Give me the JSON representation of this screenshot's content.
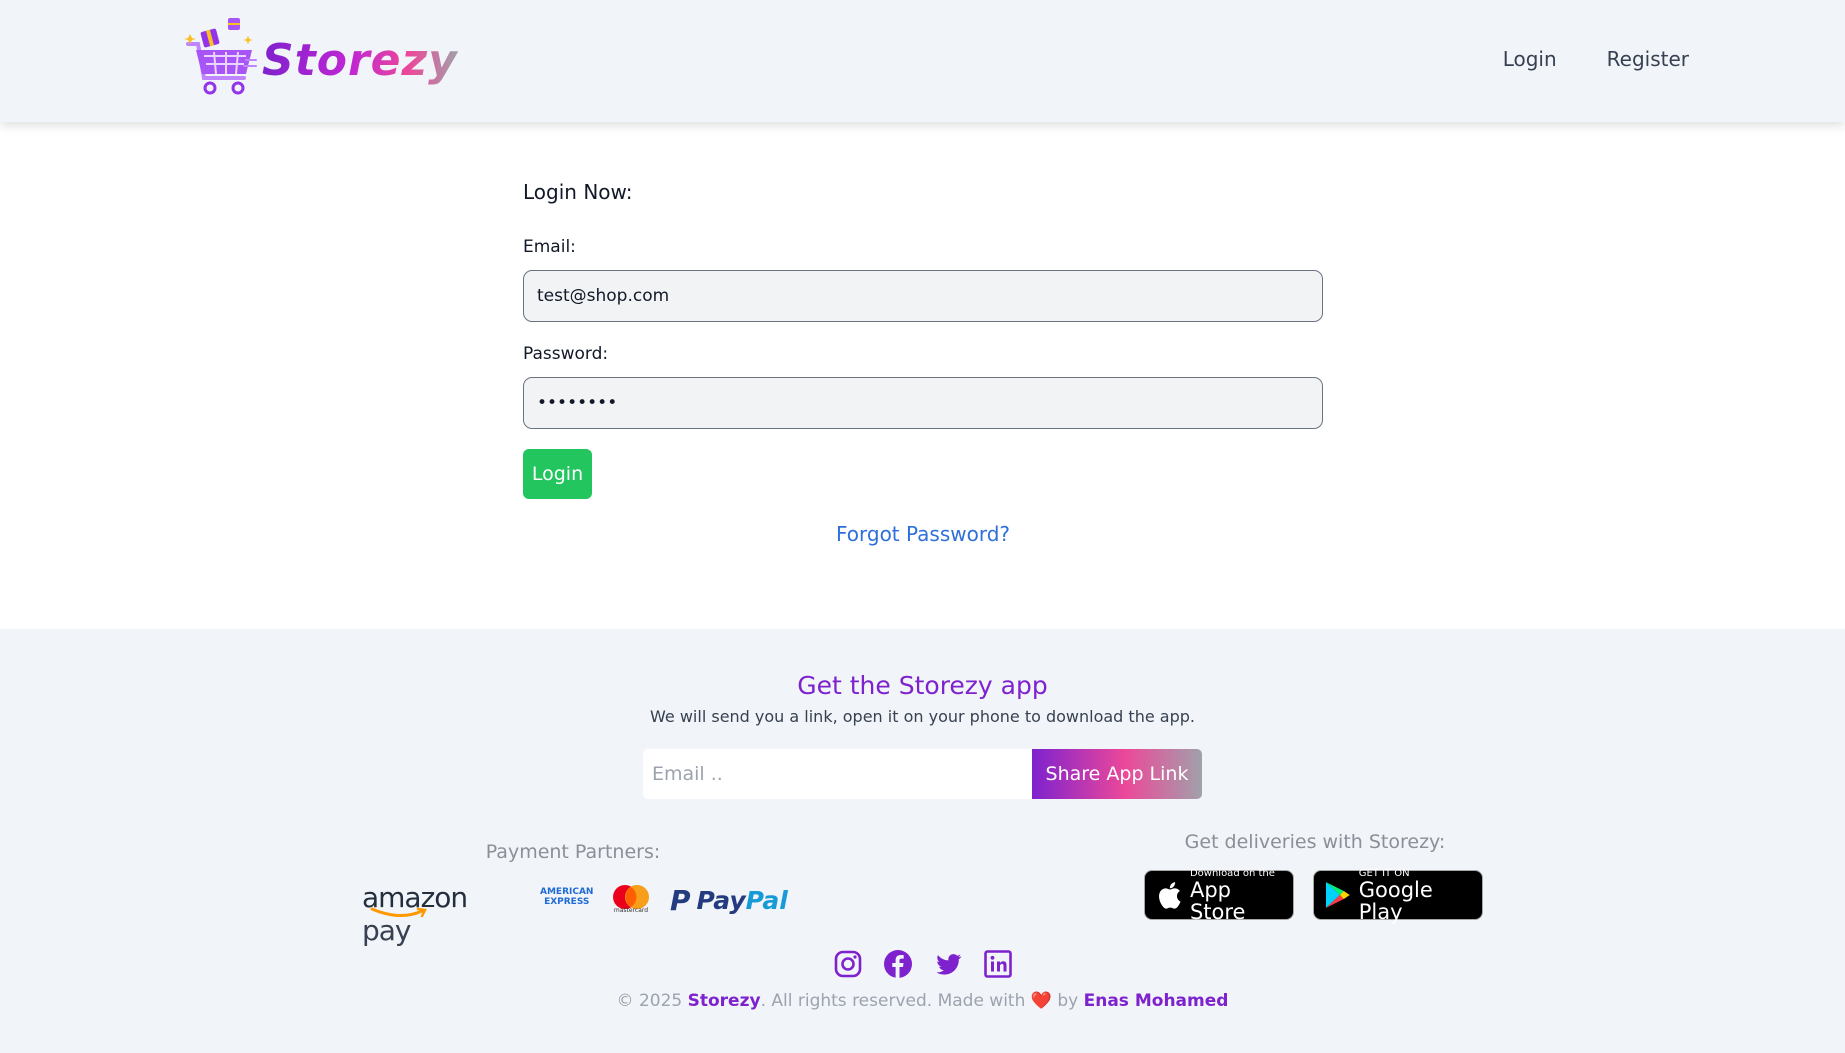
{
  "header": {
    "brand": "Storezy",
    "nav": {
      "login": "Login",
      "register": "Register"
    }
  },
  "login_form": {
    "title": "Login Now:",
    "email_label": "Email:",
    "email_value": "test@shop.com",
    "password_label": "Password:",
    "password_value": "••••••••",
    "submit_label": "Login",
    "forgot_link": "Forgot Password?"
  },
  "footer": {
    "app_title": "Get the Storezy app",
    "app_subtitle": "We will send you a link, open it on your phone to download the app.",
    "share_placeholder": "Email ..",
    "share_button": "Share App Link",
    "payment_label": "Payment Partners:",
    "delivery_label": "Get deliveries with Storezy:",
    "payment_partners": {
      "amazon": "amazon",
      "amazon_pay": "pay",
      "amex_line1": "AMERICAN",
      "amex_line2": "EXPRESS",
      "mastercard": "mastercard",
      "paypal_pay": "Pay",
      "paypal_pal": "Pal"
    },
    "app_store": {
      "small": "Download on the",
      "big": "App Store"
    },
    "google_play": {
      "small": "GET IT ON",
      "big": "Google Play"
    },
    "social_icons": [
      "instagram-icon",
      "facebook-icon",
      "twitter-icon",
      "linkedin-icon"
    ],
    "copyright": {
      "prefix": "© 2025 ",
      "brand": "Storezy",
      "middle": ". All rights reserved. Made with ",
      "heart": "❤️",
      "by": " by ",
      "author": "Enas Mohamed"
    }
  },
  "colors": {
    "accent_purple": "#7e22ce",
    "login_green": "#22c55e",
    "link_blue": "#2f6fdc",
    "header_bg": "#f1f4f8"
  }
}
